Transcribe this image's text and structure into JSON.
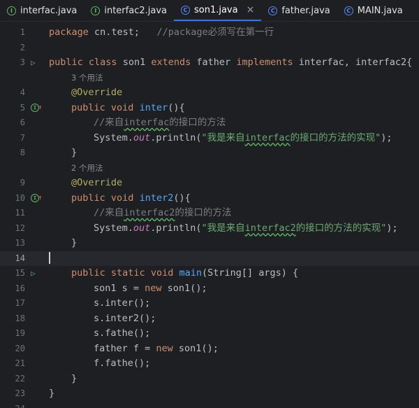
{
  "tabs": [
    {
      "label": "interfac.java",
      "kind": "interface",
      "active": false
    },
    {
      "label": "interfac2.java",
      "kind": "interface",
      "active": false
    },
    {
      "label": "son1.java",
      "kind": "class",
      "active": true,
      "close": "×"
    },
    {
      "label": "father.java",
      "kind": "class",
      "active": false
    },
    {
      "label": "MAIN.java",
      "kind": "class",
      "active": false
    }
  ],
  "tab_icons": {
    "interface": "I",
    "class": "C"
  },
  "hints": {
    "inter_usages": "3 个用法",
    "inter2_usages": "2 个用法"
  },
  "lines": {
    "1": {
      "n": "1",
      "kw": "package",
      "pkg": " cn.test;",
      "cmt": "   //package必须写在第一行"
    },
    "2": {
      "n": "2"
    },
    "3": {
      "n": "3",
      "kw1": "public",
      "kw2": "class",
      "cls": "son1",
      "kw3": "extends",
      "sup": "father",
      "kw4": "implements",
      "ifaces": "interfac, interfac2{"
    },
    "4": {
      "n": "4",
      "ann": "@Override"
    },
    "5": {
      "n": "5",
      "kw1": "public",
      "kw2": "void",
      "fn": "inter",
      "rest": "(){"
    },
    "6": {
      "n": "6",
      "c1": "//来自",
      "c2": "interfac",
      "c3": "的接口的方法"
    },
    "7": {
      "n": "7",
      "p1": "System.",
      "fld": "out",
      "p2": ".println(",
      "s1": "\"我是来自",
      "s2": "interfac",
      "s3": "的接口的方法的实现\"",
      "p3": ");"
    },
    "8": {
      "n": "8",
      "brace": "}"
    },
    "9": {
      "n": "9",
      "ann": "@Override"
    },
    "10": {
      "n": "10",
      "kw1": "public",
      "kw2": "void",
      "fn": "inter2",
      "rest": "(){"
    },
    "11": {
      "n": "11",
      "c1": "//来自",
      "c2": "interfac2",
      "c3": "的接口的方法"
    },
    "12": {
      "n": "12",
      "p1": "System.",
      "fld": "out",
      "p2": ".println(",
      "s1": "\"我是来自",
      "s2": "interfac2",
      "s3": "的接口的方法的实现\"",
      "p3": ");"
    },
    "13": {
      "n": "13",
      "brace": "}"
    },
    "14": {
      "n": "14"
    },
    "15": {
      "n": "15",
      "kw1": "public",
      "kw2": "static",
      "kw3": "void",
      "fn": "main",
      "rest": "(String[] args) {"
    },
    "16": {
      "n": "16",
      "p1": "son1 s = ",
      "kw": "new",
      "p2": " son1();"
    },
    "17": {
      "n": "17",
      "p1": "s.inter();"
    },
    "18": {
      "n": "18",
      "p1": "s.inter2();"
    },
    "19": {
      "n": "19",
      "p1": "s.fathe();"
    },
    "20": {
      "n": "20",
      "p1": "father f = ",
      "kw": "new",
      "p2": " son1();"
    },
    "21": {
      "n": "21",
      "p1": "f.fathe();"
    },
    "22": {
      "n": "22",
      "brace": "}"
    },
    "23": {
      "n": "23",
      "brace": "}"
    },
    "24": {
      "n": "24"
    }
  }
}
